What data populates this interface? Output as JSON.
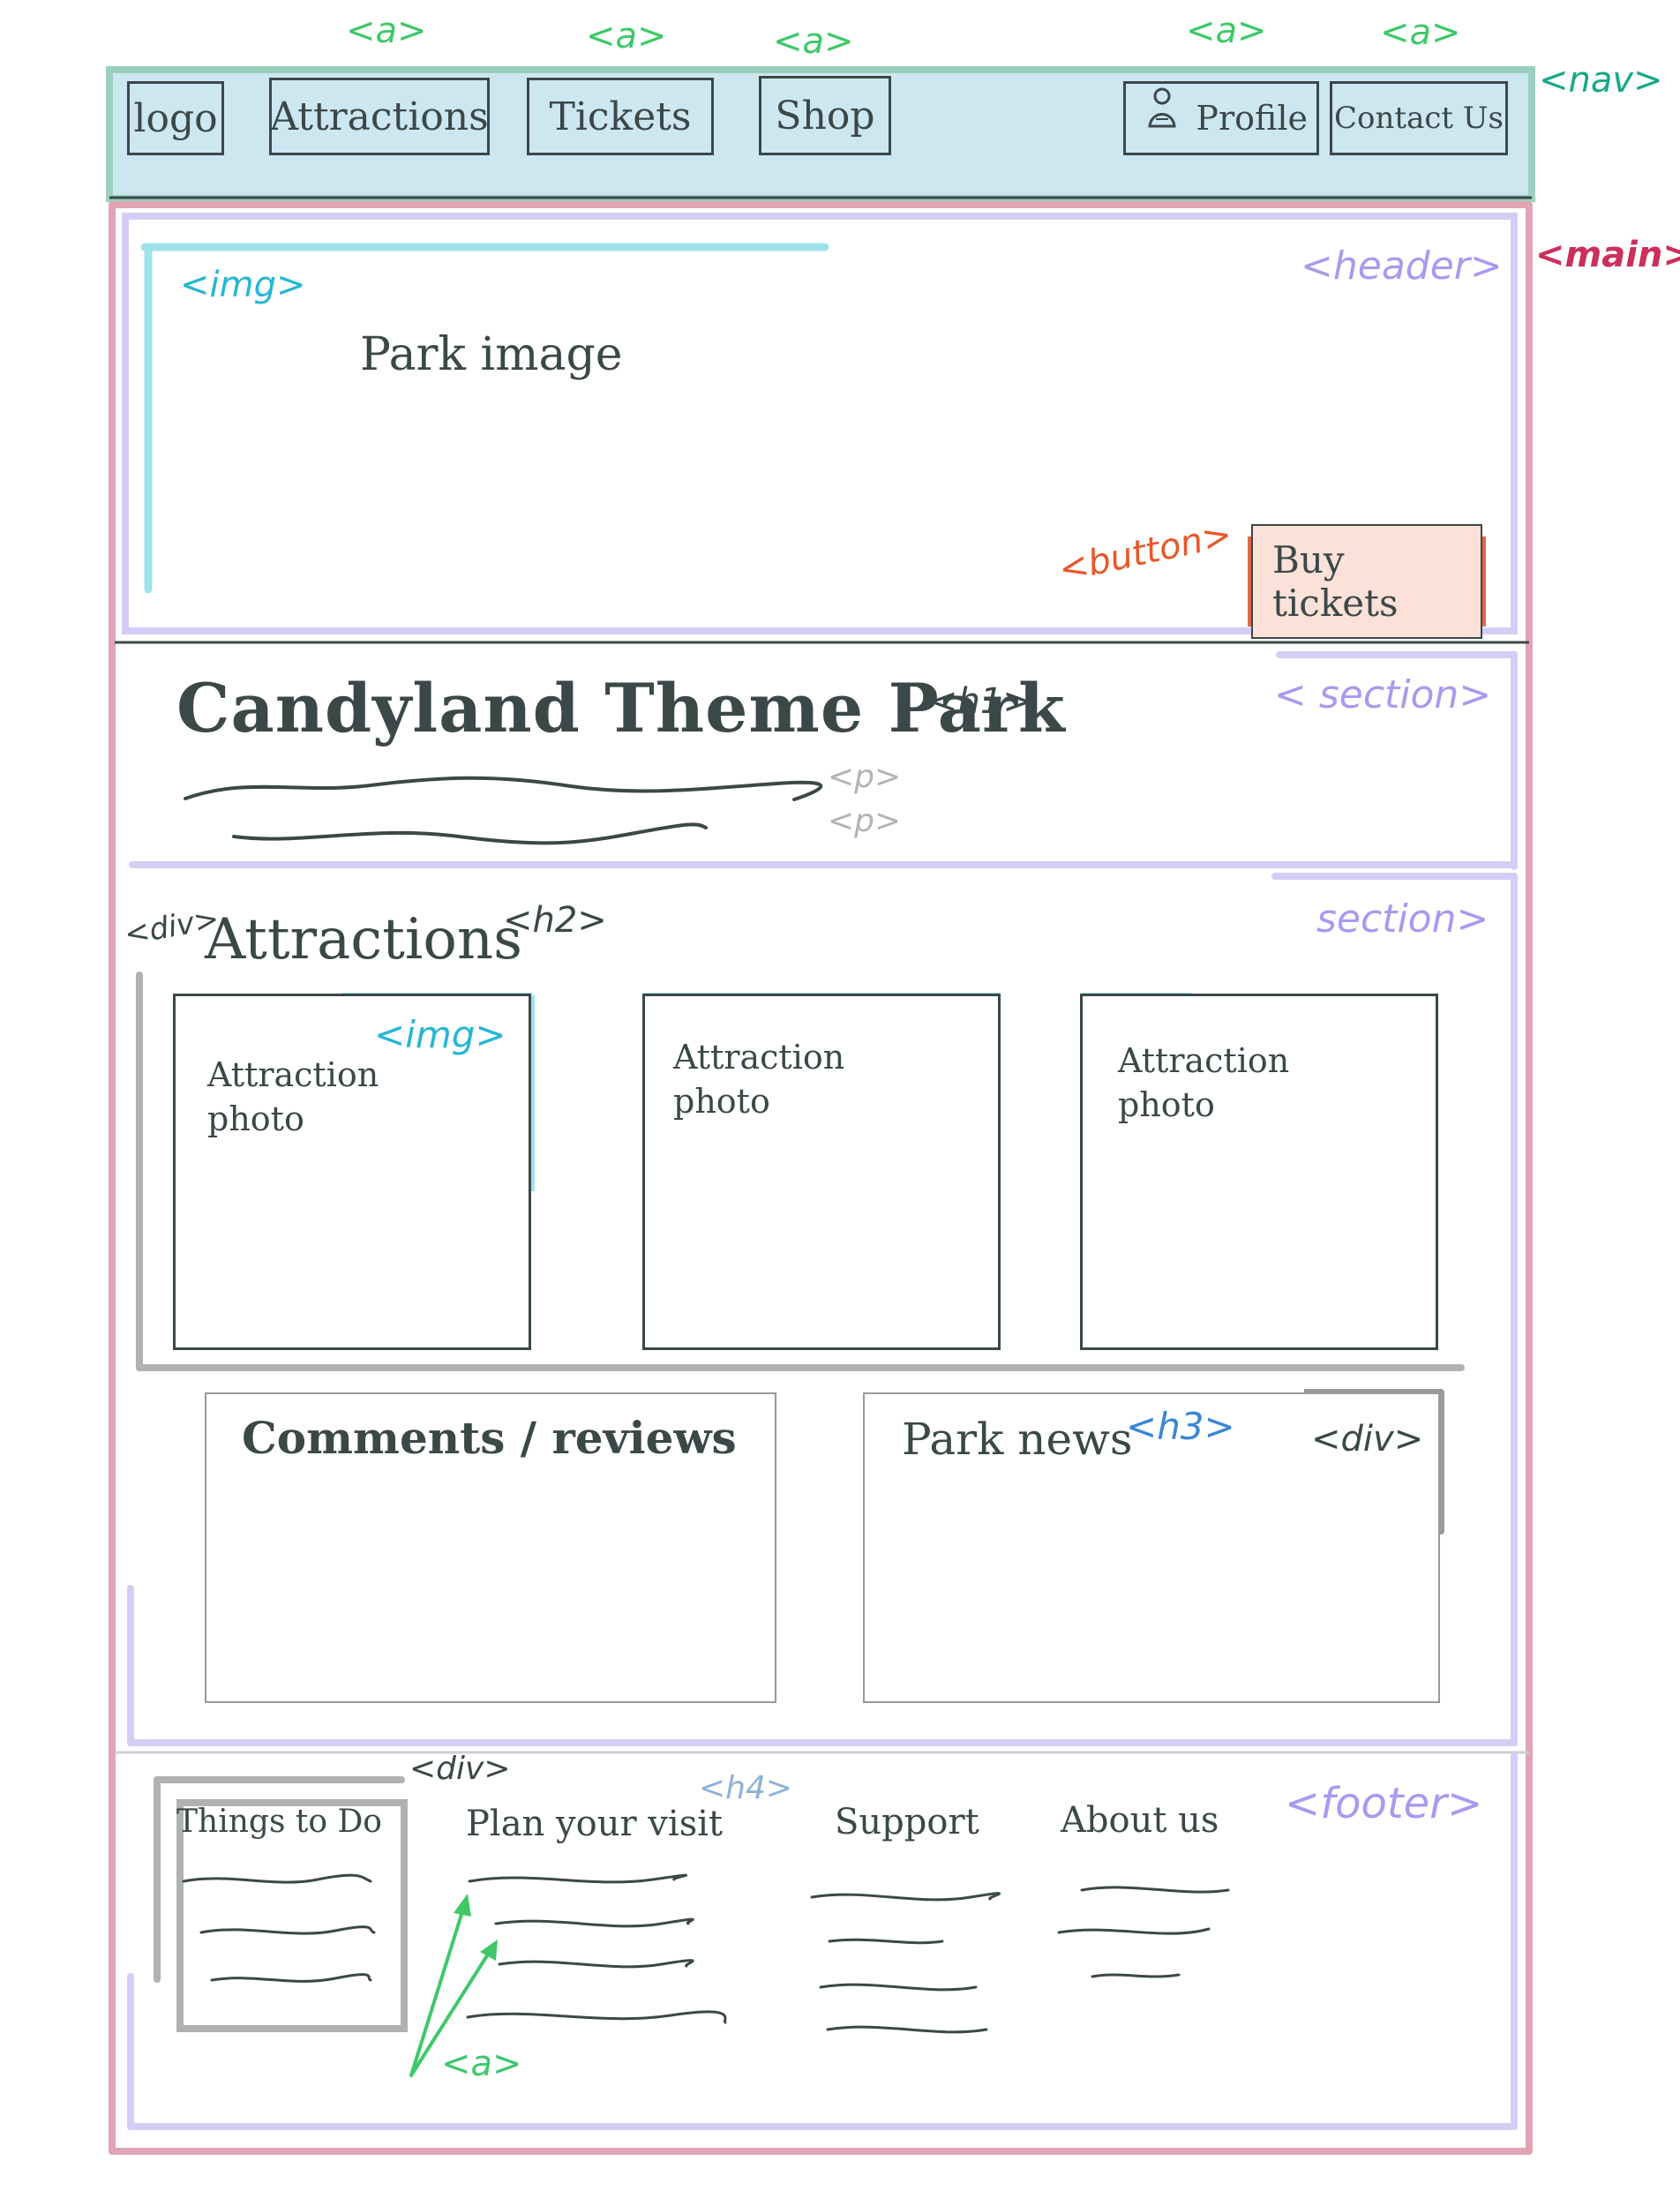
{
  "nav": {
    "tag": "<nav>",
    "link_tag": "<a>",
    "logo": "logo",
    "links": [
      "Attractions",
      "Tickets",
      "Shop"
    ],
    "profile": "Profile",
    "contact": "Contact Us"
  },
  "main_tag": "<main>",
  "header": {
    "tag": "<header>",
    "img_tag": "<img>",
    "image_text": "Park image",
    "button_tag": "<button>",
    "button_label": "Buy tickets"
  },
  "intro": {
    "tag": "< section>",
    "title": "Candyland Theme Park",
    "title_tag": "<h1>",
    "p_tag": "<p>"
  },
  "attractions": {
    "tag": "section>",
    "div_tag": "<div>",
    "heading": "Attractions",
    "heading_tag": "<h2>",
    "img_tag": "<img>",
    "photos": [
      "Attraction\nphoto",
      "Attraction\nphoto",
      "Attraction\nphoto"
    ],
    "comments_title": "Comments / reviews",
    "news_title": "Park news",
    "news_tag": "<h3>",
    "news_div_tag": "<div>"
  },
  "footer": {
    "tag": "<footer>",
    "div_tag": "<div>",
    "h4_tag": "<h4>",
    "a_tag": "<a>",
    "columns": [
      "Things to Do",
      "Plan your visit",
      "Support",
      "About us"
    ]
  },
  "colors": {
    "nav_fill": "#cde7f1",
    "nav_outline": "#9ccfbe",
    "main_outline": "#dfa5b5",
    "lavender": "#a99af0",
    "cyan": "#27b6d6",
    "ink": "#3b4848",
    "button": "#e06a4a"
  }
}
